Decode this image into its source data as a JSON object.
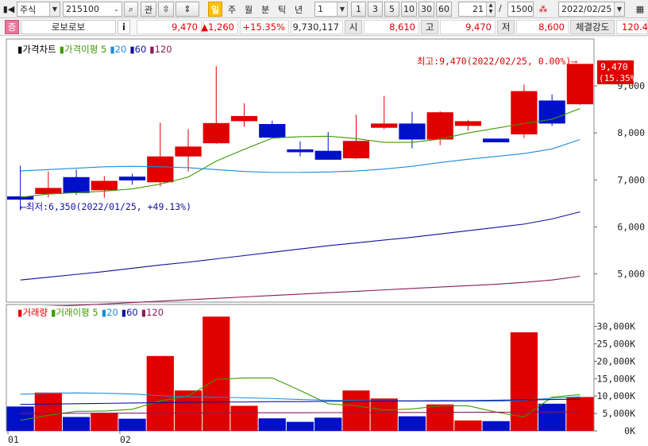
{
  "toolbar": {
    "market": "주식",
    "code": "215100",
    "btn_search": "⌕",
    "btn_watch": "관",
    "period_active": "일",
    "period_week": "주",
    "period_month": "월",
    "period_min": "분",
    "period_tick": "틱",
    "period_year": "년",
    "unit_value": "1",
    "n1": "1",
    "n3": "3",
    "n5": "5",
    "n10": "10",
    "n30": "30",
    "n60": "60",
    "count_value": "21",
    "slash": "/",
    "total_value": "1500",
    "date_value": "2022/02/25"
  },
  "quote": {
    "badge": "증",
    "name": "로보로보",
    "info_btn": "i",
    "price": "9,470",
    "change": "▲1,260",
    "change_pct": "+15.35%",
    "volume": "9,730,117",
    "open_label": "시",
    "open": "8,610",
    "high_label": "고",
    "high": "9,470",
    "low_label": "저",
    "low": "8,600",
    "strength_label": "체결강도",
    "strength": "120.4"
  },
  "price_legend": {
    "title": "가격차트",
    "ma_label": "가격이평",
    "p5": "5",
    "p20": "20",
    "p60": "60",
    "p120": "120"
  },
  "volume_legend": {
    "title": "거래량",
    "ma_label": "거래이평",
    "p5": "5",
    "p20": "20",
    "p60": "60",
    "p120": "120"
  },
  "annotations": {
    "high_note": "최고:9,470(2022/02/25, 0.00%)⟶",
    "low_note": "⟵최저:6,350(2022/01/25, +49.13%)",
    "last_price": "9,470",
    "last_pct": "(15.35%)"
  },
  "x_labels": [
    "01",
    "02"
  ],
  "colors": {
    "up": "#e00000",
    "down": "#0010c8",
    "ma5": "#3c9a00",
    "ma20": "#1e8cd8",
    "ma60": "#1010a0",
    "ma120": "#8b1a5a"
  },
  "chart_data": [
    {
      "type": "candlestick",
      "title": "가격차트",
      "ylim": [
        4400,
        10000
      ],
      "y_ticks": [
        5000,
        6000,
        7000,
        8000,
        9000
      ],
      "y_tick_labels": [
        "5,000",
        "6,000",
        "7,000",
        "8,000",
        "9,000"
      ],
      "candles": [
        {
          "open": 6650,
          "high": 7300,
          "low": 6350,
          "close": 6580
        },
        {
          "open": 6700,
          "high": 7180,
          "low": 6630,
          "close": 6830
        },
        {
          "open": 7060,
          "high": 7220,
          "low": 6680,
          "close": 6720
        },
        {
          "open": 6780,
          "high": 7080,
          "low": 6620,
          "close": 6980
        },
        {
          "open": 7070,
          "high": 7130,
          "low": 6900,
          "close": 6990
        },
        {
          "open": 6950,
          "high": 8220,
          "low": 6860,
          "close": 7500
        },
        {
          "open": 7500,
          "high": 8080,
          "low": 7180,
          "close": 7710
        },
        {
          "open": 7780,
          "high": 9420,
          "low": 7770,
          "close": 8210
        },
        {
          "open": 8250,
          "high": 8630,
          "low": 8130,
          "close": 8360
        },
        {
          "open": 8190,
          "high": 8260,
          "low": 7880,
          "close": 7900
        },
        {
          "open": 7650,
          "high": 7820,
          "low": 7500,
          "close": 7590
        },
        {
          "open": 7620,
          "high": 8020,
          "low": 7470,
          "close": 7430
        },
        {
          "open": 7460,
          "high": 8390,
          "low": 7450,
          "close": 7830
        },
        {
          "open": 8110,
          "high": 8790,
          "low": 8080,
          "close": 8200
        },
        {
          "open": 8200,
          "high": 8450,
          "low": 7670,
          "close": 7860
        },
        {
          "open": 7860,
          "high": 8460,
          "low": 7740,
          "close": 8440
        },
        {
          "open": 8150,
          "high": 8280,
          "low": 8050,
          "close": 8250
        },
        {
          "open": 7880,
          "high": 7880,
          "low": 7800,
          "close": 7800
        },
        {
          "open": 7970,
          "high": 9030,
          "low": 7890,
          "close": 8890
        },
        {
          "open": 8690,
          "high": 8820,
          "low": 8150,
          "close": 8200
        },
        {
          "open": 8610,
          "high": 9470,
          "low": 8600,
          "close": 9470
        }
      ],
      "series": [
        {
          "name": "5",
          "values": [
            6630,
            6700,
            6730,
            6760,
            6810,
            6910,
            7060,
            7400,
            7650,
            7890,
            7920,
            7930,
            7880,
            7800,
            7800,
            7870,
            8000,
            8100,
            8200,
            8290,
            8520
          ]
        },
        {
          "name": "20",
          "values": [
            7190,
            7220,
            7250,
            7280,
            7290,
            7280,
            7260,
            7220,
            7180,
            7160,
            7160,
            7170,
            7190,
            7230,
            7290,
            7370,
            7440,
            7500,
            7560,
            7660,
            7860
          ]
        },
        {
          "name": "60",
          "values": [
            4870,
            4930,
            4990,
            5050,
            5120,
            5190,
            5250,
            5320,
            5390,
            5460,
            5530,
            5600,
            5660,
            5720,
            5780,
            5850,
            5920,
            5990,
            6060,
            6170,
            6320
          ]
        },
        {
          "name": "120",
          "values": [
            4290,
            4310,
            4330,
            4360,
            4390,
            4420,
            4450,
            4480,
            4510,
            4540,
            4570,
            4600,
            4630,
            4660,
            4690,
            4720,
            4750,
            4780,
            4820,
            4870,
            4950
          ]
        }
      ]
    },
    {
      "type": "bar",
      "title": "거래량",
      "ylim": [
        0,
        34000
      ],
      "y_ticks": [
        0,
        5000,
        10000,
        15000,
        20000,
        25000,
        30000
      ],
      "y_tick_labels": [
        "0K",
        "5,000K",
        "10,000K",
        "15,000K",
        "20,000K",
        "25,000K",
        "30,000K"
      ],
      "values": [
        7000,
        11000,
        4000,
        5200,
        3500,
        21500,
        11600,
        32800,
        7200,
        3600,
        2600,
        3800,
        11600,
        9300,
        4200,
        7600,
        3000,
        2800,
        28300,
        7800,
        9730
      ],
      "series": [
        {
          "name": "5",
          "values": [
            3000,
            4500,
            5600,
            5700,
            6200,
            8600,
            10000,
            14800,
            15200,
            15200,
            11600,
            7800,
            7200,
            6000,
            6300,
            7200,
            7200,
            5400,
            4000,
            9700,
            10400
          ]
        },
        {
          "name": "20",
          "values": [
            10500,
            10800,
            10900,
            10800,
            10600,
            10100,
            9800,
            9700,
            9500,
            9300,
            9000,
            8800,
            8700,
            8600,
            8600,
            8500,
            8500,
            8500,
            8800,
            9400,
            9800
          ]
        },
        {
          "name": "60",
          "values": [
            7600,
            7700,
            7800,
            7900,
            8000,
            8100,
            8200,
            8300,
            8300,
            8400,
            8400,
            8500,
            8500,
            8600,
            8600,
            8700,
            8700,
            8800,
            8900,
            9000,
            9100
          ]
        },
        {
          "name": "120",
          "values": [
            5000,
            5000,
            5050,
            5050,
            5100,
            5100,
            5150,
            5150,
            5200,
            5200,
            5200,
            5250,
            5250,
            5300,
            5300,
            5300,
            5350,
            5350,
            5400,
            5400,
            5450
          ]
        }
      ]
    }
  ]
}
